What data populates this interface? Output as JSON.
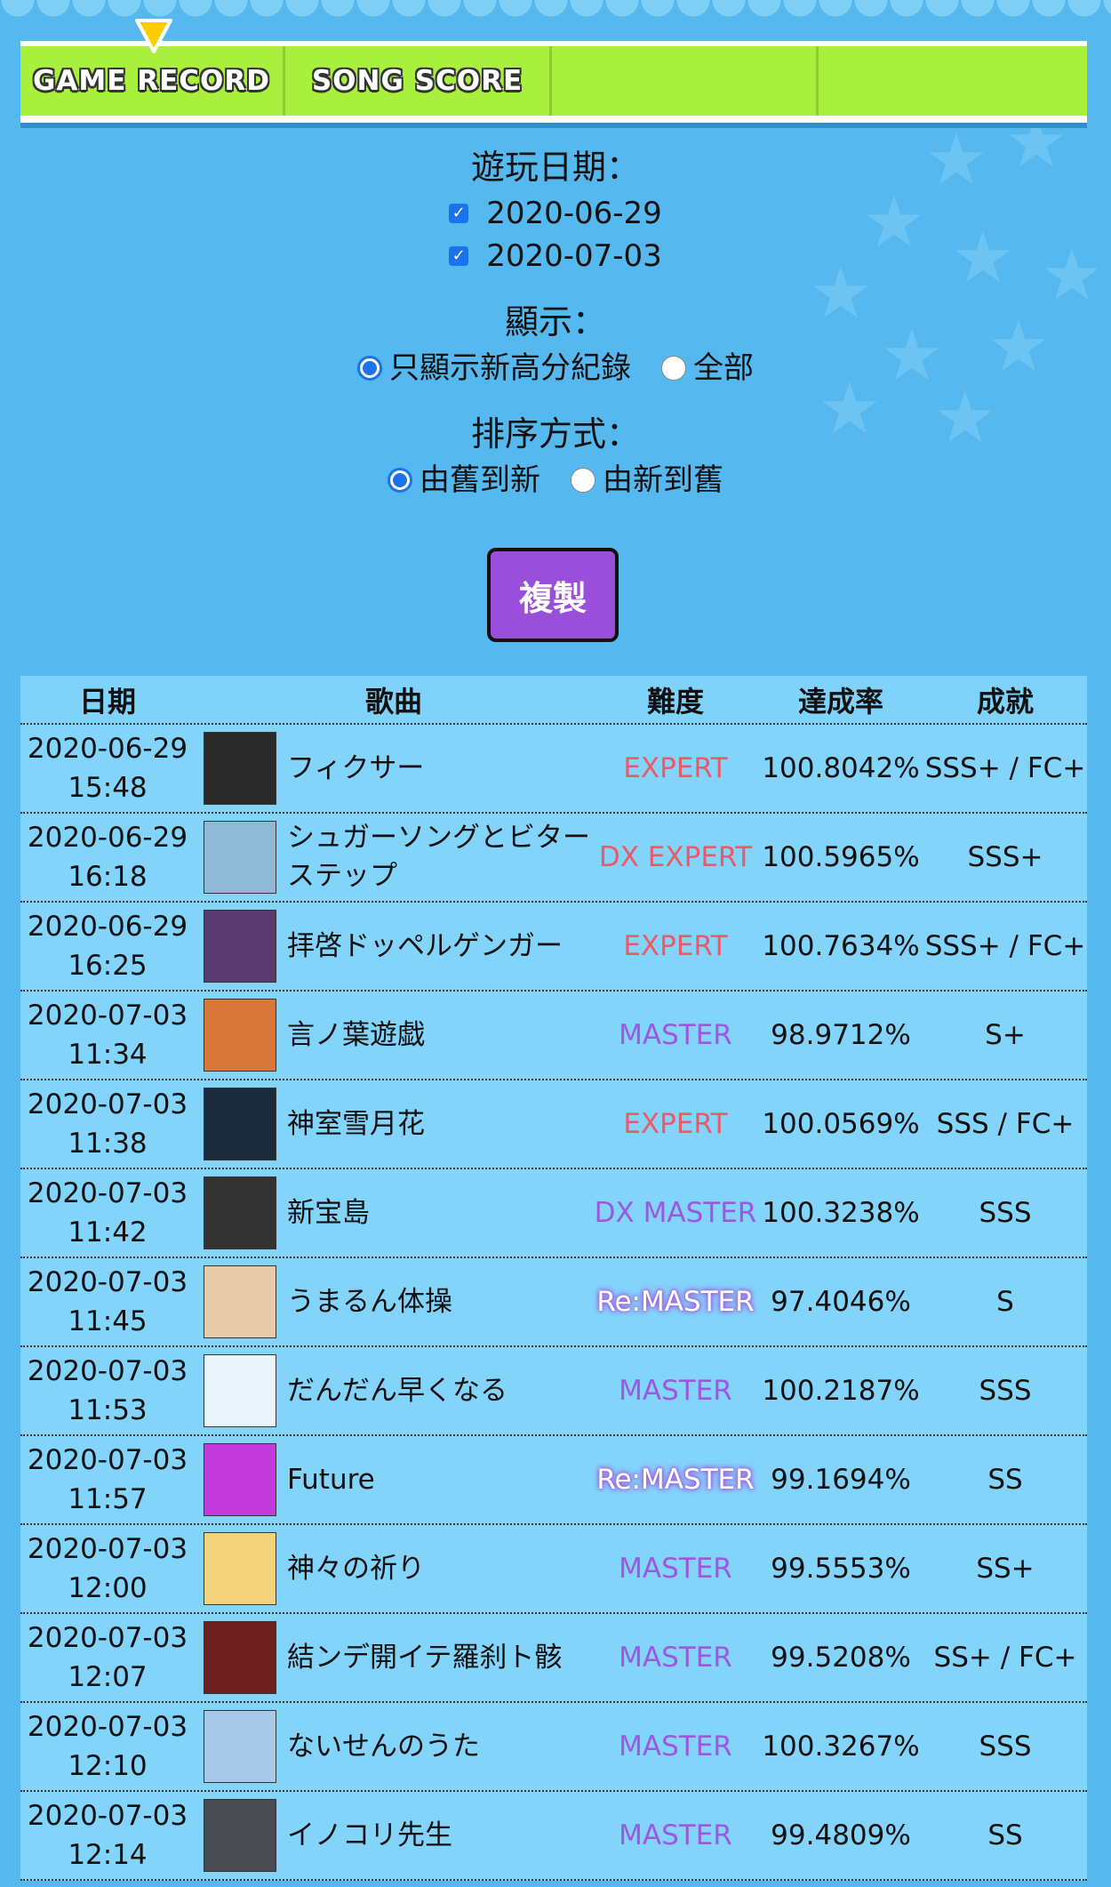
{
  "nav": {
    "tabs": [
      {
        "label": "GAME RECORD",
        "active": true
      },
      {
        "label": "SONG SCORE",
        "active": false
      },
      {
        "label": "",
        "active": false
      },
      {
        "label": "",
        "active": false
      }
    ]
  },
  "filters": {
    "date_label": "遊玩日期：",
    "dates": [
      {
        "label": "2020-06-29",
        "checked": true
      },
      {
        "label": "2020-07-03",
        "checked": true
      }
    ],
    "display_label": "顯示：",
    "display_options": [
      {
        "label": "只顯示新高分紀錄",
        "selected": true
      },
      {
        "label": "全部",
        "selected": false
      }
    ],
    "sort_label": "排序方式：",
    "sort_options": [
      {
        "label": "由舊到新",
        "selected": true
      },
      {
        "label": "由新到舊",
        "selected": false
      }
    ]
  },
  "copy_button": "複製",
  "table": {
    "headers": [
      "日期",
      "歌曲",
      "難度",
      "達成率",
      "成就"
    ],
    "rows": [
      {
        "date": "2020-06-29",
        "time": "15:48",
        "song": "フィクサー",
        "difficulty": "EXPERT",
        "diff_class": "expert",
        "rate": "100.8042%",
        "achievement": "SSS+ / FC+",
        "jacket_color": "#2a2a2a"
      },
      {
        "date": "2020-06-29",
        "time": "16:18",
        "song": "シュガーソングとビターステップ",
        "difficulty": "DX EXPERT",
        "diff_class": "expert",
        "rate": "100.5965%",
        "achievement": "SSS+",
        "jacket_color": "#8fb9d6"
      },
      {
        "date": "2020-06-29",
        "time": "16:25",
        "song": "拝啓ドッペルゲンガー",
        "difficulty": "EXPERT",
        "diff_class": "expert",
        "rate": "100.7634%",
        "achievement": "SSS+ / FC+",
        "jacket_color": "#5a3a6e"
      },
      {
        "date": "2020-07-03",
        "time": "11:34",
        "song": "言ノ葉遊戯",
        "difficulty": "MASTER",
        "diff_class": "master",
        "rate": "98.9712%",
        "achievement": "S+",
        "jacket_color": "#d9763a"
      },
      {
        "date": "2020-07-03",
        "time": "11:38",
        "song": "神室雪月花",
        "difficulty": "EXPERT",
        "diff_class": "expert",
        "rate": "100.0569%",
        "achievement": "SSS / FC+",
        "jacket_color": "#1a2a3a"
      },
      {
        "date": "2020-07-03",
        "time": "11:42",
        "song": "新宝島",
        "difficulty": "DX MASTER",
        "diff_class": "master",
        "rate": "100.3238%",
        "achievement": "SSS",
        "jacket_color": "#333333"
      },
      {
        "date": "2020-07-03",
        "time": "11:45",
        "song": "うまるん体操",
        "difficulty": "Re:MASTER",
        "diff_class": "remaster",
        "rate": "97.4046%",
        "achievement": "S",
        "jacket_color": "#e8c9a8"
      },
      {
        "date": "2020-07-03",
        "time": "11:53",
        "song": "だんだん早くなる",
        "difficulty": "MASTER",
        "diff_class": "master",
        "rate": "100.2187%",
        "achievement": "SSS",
        "jacket_color": "#eaf4fb"
      },
      {
        "date": "2020-07-03",
        "time": "11:57",
        "song": "Future",
        "difficulty": "Re:MASTER",
        "diff_class": "remaster",
        "rate": "99.1694%",
        "achievement": "SS",
        "jacket_color": "#c23ad9"
      },
      {
        "date": "2020-07-03",
        "time": "12:00",
        "song": "神々の祈り",
        "difficulty": "MASTER",
        "diff_class": "master",
        "rate": "99.5553%",
        "achievement": "SS+",
        "jacket_color": "#f2d27a"
      },
      {
        "date": "2020-07-03",
        "time": "12:07",
        "song": "結ンデ開イテ羅刹ト骸",
        "difficulty": "MASTER",
        "diff_class": "master",
        "rate": "99.5208%",
        "achievement": "SS+ / FC+",
        "jacket_color": "#6e1f1f"
      },
      {
        "date": "2020-07-03",
        "time": "12:10",
        "song": "ないせんのうた",
        "difficulty": "MASTER",
        "diff_class": "master",
        "rate": "100.3267%",
        "achievement": "SSS",
        "jacket_color": "#a8c8ea"
      },
      {
        "date": "2020-07-03",
        "time": "12:14",
        "song": "イノコリ先生",
        "difficulty": "MASTER",
        "diff_class": "master",
        "rate": "99.4809%",
        "achievement": "SS",
        "jacket_color": "#4a4a52"
      }
    ]
  }
}
